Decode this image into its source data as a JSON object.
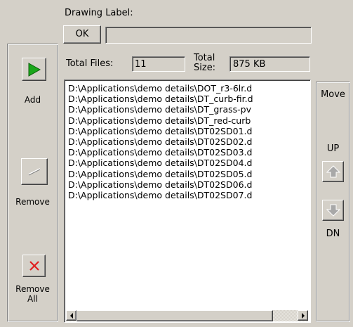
{
  "drawing_label": {
    "caption": "Drawing Label:",
    "ok_label": "OK",
    "value": ""
  },
  "left_toolbar": {
    "add_label": "Add",
    "remove_label": "Remove",
    "remove_all_line1": "Remove",
    "remove_all_line2": "All"
  },
  "stats": {
    "total_files_label": "Total Files:",
    "total_files_value": "11",
    "total_size_line1": "Total",
    "total_size_line2": "Size:",
    "total_size_value": "875 KB"
  },
  "files": [
    "D:\\Applications\\demo details\\DOT_r3-6lr.d",
    "D:\\Applications\\demo details\\DT_curb-fir.d",
    "D:\\Applications\\demo details\\DT_grass-pv",
    "D:\\Applications\\demo details\\DT_red-curb",
    "D:\\Applications\\demo details\\DT02SD01.d",
    "D:\\Applications\\demo details\\DT02SD02.d",
    "D:\\Applications\\demo details\\DT02SD03.d",
    "D:\\Applications\\demo details\\DT02SD04.d",
    "D:\\Applications\\demo details\\DT02SD05.d",
    "D:\\Applications\\demo details\\DT02SD06.d",
    "D:\\Applications\\demo details\\DT02SD07.d"
  ],
  "move_panel": {
    "title": "Move",
    "up_label": "UP",
    "dn_label": "DN"
  },
  "colors": {
    "add_arrow": "#1aa61a",
    "remove_all_x": "#e02020"
  },
  "icons": {
    "add": "play-arrow-icon",
    "remove": "slash-icon",
    "remove_all": "x-icon",
    "up": "arrow-up-icon",
    "down": "arrow-down-icon"
  }
}
